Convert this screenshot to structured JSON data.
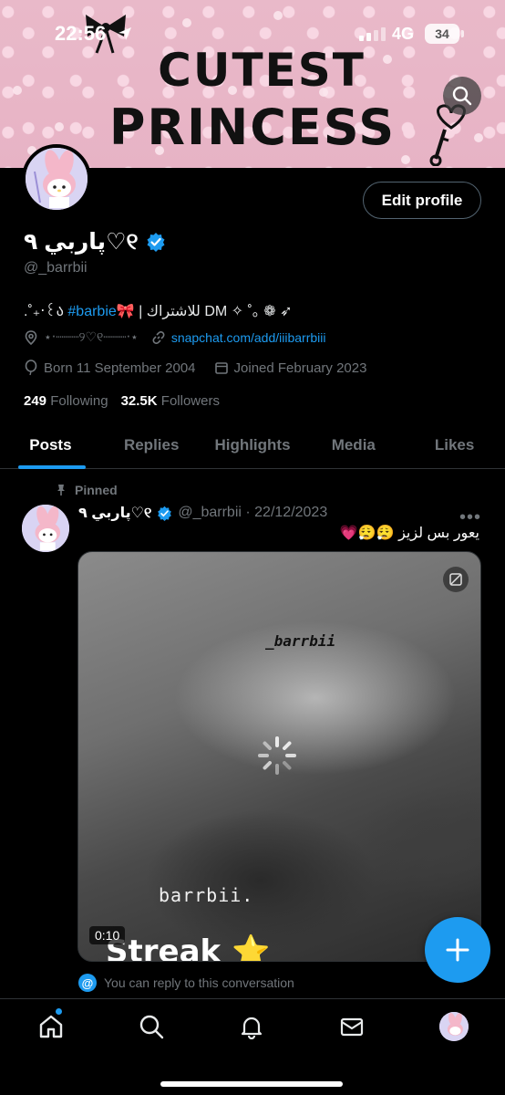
{
  "status_bar": {
    "time": "22:56",
    "network": "4G",
    "battery": "34"
  },
  "banner": {
    "line1": "CUTEST",
    "line2": "PRINCESS"
  },
  "profile": {
    "edit_label": "Edit profile",
    "display_name": "پاربي ٩♡୧",
    "handle": "@_barrbii",
    "bio_prefix": ".˚₊‧꒰ა",
    "bio_tag": "#barbie🎀",
    "bio_suffix": "| للاشتراك DM ✧ ˚｡ ❁ ➶",
    "location": "⋆‧┈┈┈୨♡୧┈┈┈‧⋆",
    "link": "snapchat.com/add/iiibarrbiii",
    "born": "Born 11 September 2004",
    "joined": "Joined February 2023",
    "following_count": "249",
    "following_label": "Following",
    "followers_count": "32.5K",
    "followers_label": "Followers"
  },
  "tabs": [
    {
      "label": "Posts"
    },
    {
      "label": "Replies"
    },
    {
      "label": "Highlights"
    },
    {
      "label": "Media"
    },
    {
      "label": "Likes"
    }
  ],
  "post": {
    "pinned_label": "Pinned",
    "name": "پاربي ٩♡୧",
    "handle_date": "@_barrbii · 22/12/2023",
    "text": "يعور بس لزيز 😮‍💨😮‍💨💗",
    "media": {
      "watermark_top": "_barrbii",
      "watermark_bottom": "barrbii.",
      "caption": "Streak ⭐",
      "duration": "0:10"
    },
    "reply_note": "You can reply to this conversation"
  },
  "colors": {
    "accent": "#1d9bf0",
    "background": "#000000",
    "muted": "#71767b",
    "banner": "#e9b9c9"
  },
  "icons": {
    "nav": [
      "home-icon",
      "search-icon",
      "bell-icon",
      "mail-icon",
      "profile-avatar"
    ],
    "compose": "plus-icon"
  }
}
